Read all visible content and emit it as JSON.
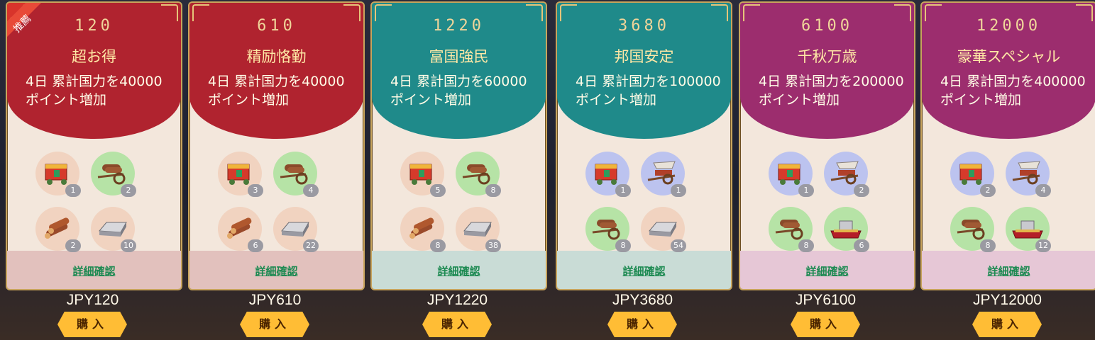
{
  "badge_recommend": "推薦",
  "detail_label": "詳細確認",
  "buy_label": "購入",
  "packs": [
    {
      "price_top": "120",
      "title": "超お得",
      "desc": "4日 累計国力を40000ポイント増加",
      "jpy": "JPY120",
      "theme": "red",
      "recommended": true,
      "items": [
        {
          "icon": "gift-cart-icon",
          "count": "1",
          "bg": "peach"
        },
        {
          "icon": "wood-cart-icon",
          "count": "2",
          "bg": "green"
        },
        {
          "icon": "logs-icon",
          "count": "2",
          "bg": "peach"
        },
        {
          "icon": "silver-ingot-icon",
          "count": "10",
          "bg": "peach"
        }
      ]
    },
    {
      "price_top": "610",
      "title": "精励恪勤",
      "desc": "4日 累計国力を40000ポイント増加",
      "jpy": "JPY610",
      "theme": "red",
      "recommended": false,
      "items": [
        {
          "icon": "gift-cart-icon",
          "count": "3",
          "bg": "peach"
        },
        {
          "icon": "wood-cart-icon",
          "count": "4",
          "bg": "green"
        },
        {
          "icon": "logs-icon",
          "count": "6",
          "bg": "peach"
        },
        {
          "icon": "silver-ingot-icon",
          "count": "22",
          "bg": "peach"
        }
      ]
    },
    {
      "price_top": "1220",
      "title": "富国強民",
      "desc": "4日 累計国力を60000ポイント増加",
      "jpy": "JPY1220",
      "theme": "teal",
      "recommended": false,
      "items": [
        {
          "icon": "gift-cart-icon",
          "count": "5",
          "bg": "peach"
        },
        {
          "icon": "wood-cart-icon",
          "count": "8",
          "bg": "green"
        },
        {
          "icon": "logs-icon",
          "count": "8",
          "bg": "peach"
        },
        {
          "icon": "silver-ingot-icon",
          "count": "38",
          "bg": "peach"
        }
      ]
    },
    {
      "price_top": "3680",
      "title": "邦国安定",
      "desc": "4日 累計国力を100000ポイント増加",
      "jpy": "JPY3680",
      "theme": "teal",
      "recommended": false,
      "items": [
        {
          "icon": "gift-cart-icon",
          "count": "1",
          "bg": "blue"
        },
        {
          "icon": "canopy-cart-icon",
          "count": "1",
          "bg": "blue"
        },
        {
          "icon": "wood-cart-icon",
          "count": "8",
          "bg": "green"
        },
        {
          "icon": "silver-ingot-icon",
          "count": "54",
          "bg": "peach"
        }
      ]
    },
    {
      "price_top": "6100",
      "title": "千秋万歳",
      "desc": "4日 累計国力を200000ポイント増加",
      "jpy": "JPY6100",
      "theme": "magenta",
      "recommended": false,
      "items": [
        {
          "icon": "gift-cart-icon",
          "count": "1",
          "bg": "blue"
        },
        {
          "icon": "canopy-cart-icon",
          "count": "2",
          "bg": "blue"
        },
        {
          "icon": "wood-cart-icon",
          "count": "8",
          "bg": "green"
        },
        {
          "icon": "silver-chest-icon",
          "count": "6",
          "bg": "green"
        }
      ]
    },
    {
      "price_top": "12000",
      "title": "豪華スペシャル",
      "desc": "4日 累計国力を400000ポイント増加",
      "jpy": "JPY12000",
      "theme": "magenta",
      "recommended": false,
      "items": [
        {
          "icon": "gift-cart-icon",
          "count": "2",
          "bg": "blue"
        },
        {
          "icon": "canopy-cart-icon",
          "count": "4",
          "bg": "blue"
        },
        {
          "icon": "wood-cart-icon",
          "count": "8",
          "bg": "green"
        },
        {
          "icon": "silver-chest-icon",
          "count": "12",
          "bg": "green"
        }
      ]
    }
  ],
  "colors": {
    "red_head": "#b0232f",
    "teal_head": "#1f8a8a",
    "magenta_head": "#9c2d6e",
    "red_band": "#e2c1bd",
    "teal_band": "#c9dcd6",
    "magenta_band": "#e6c7d6",
    "peach": "#f1d3c0",
    "green": "#b6e3a6",
    "blue": "#bcc3ef"
  }
}
